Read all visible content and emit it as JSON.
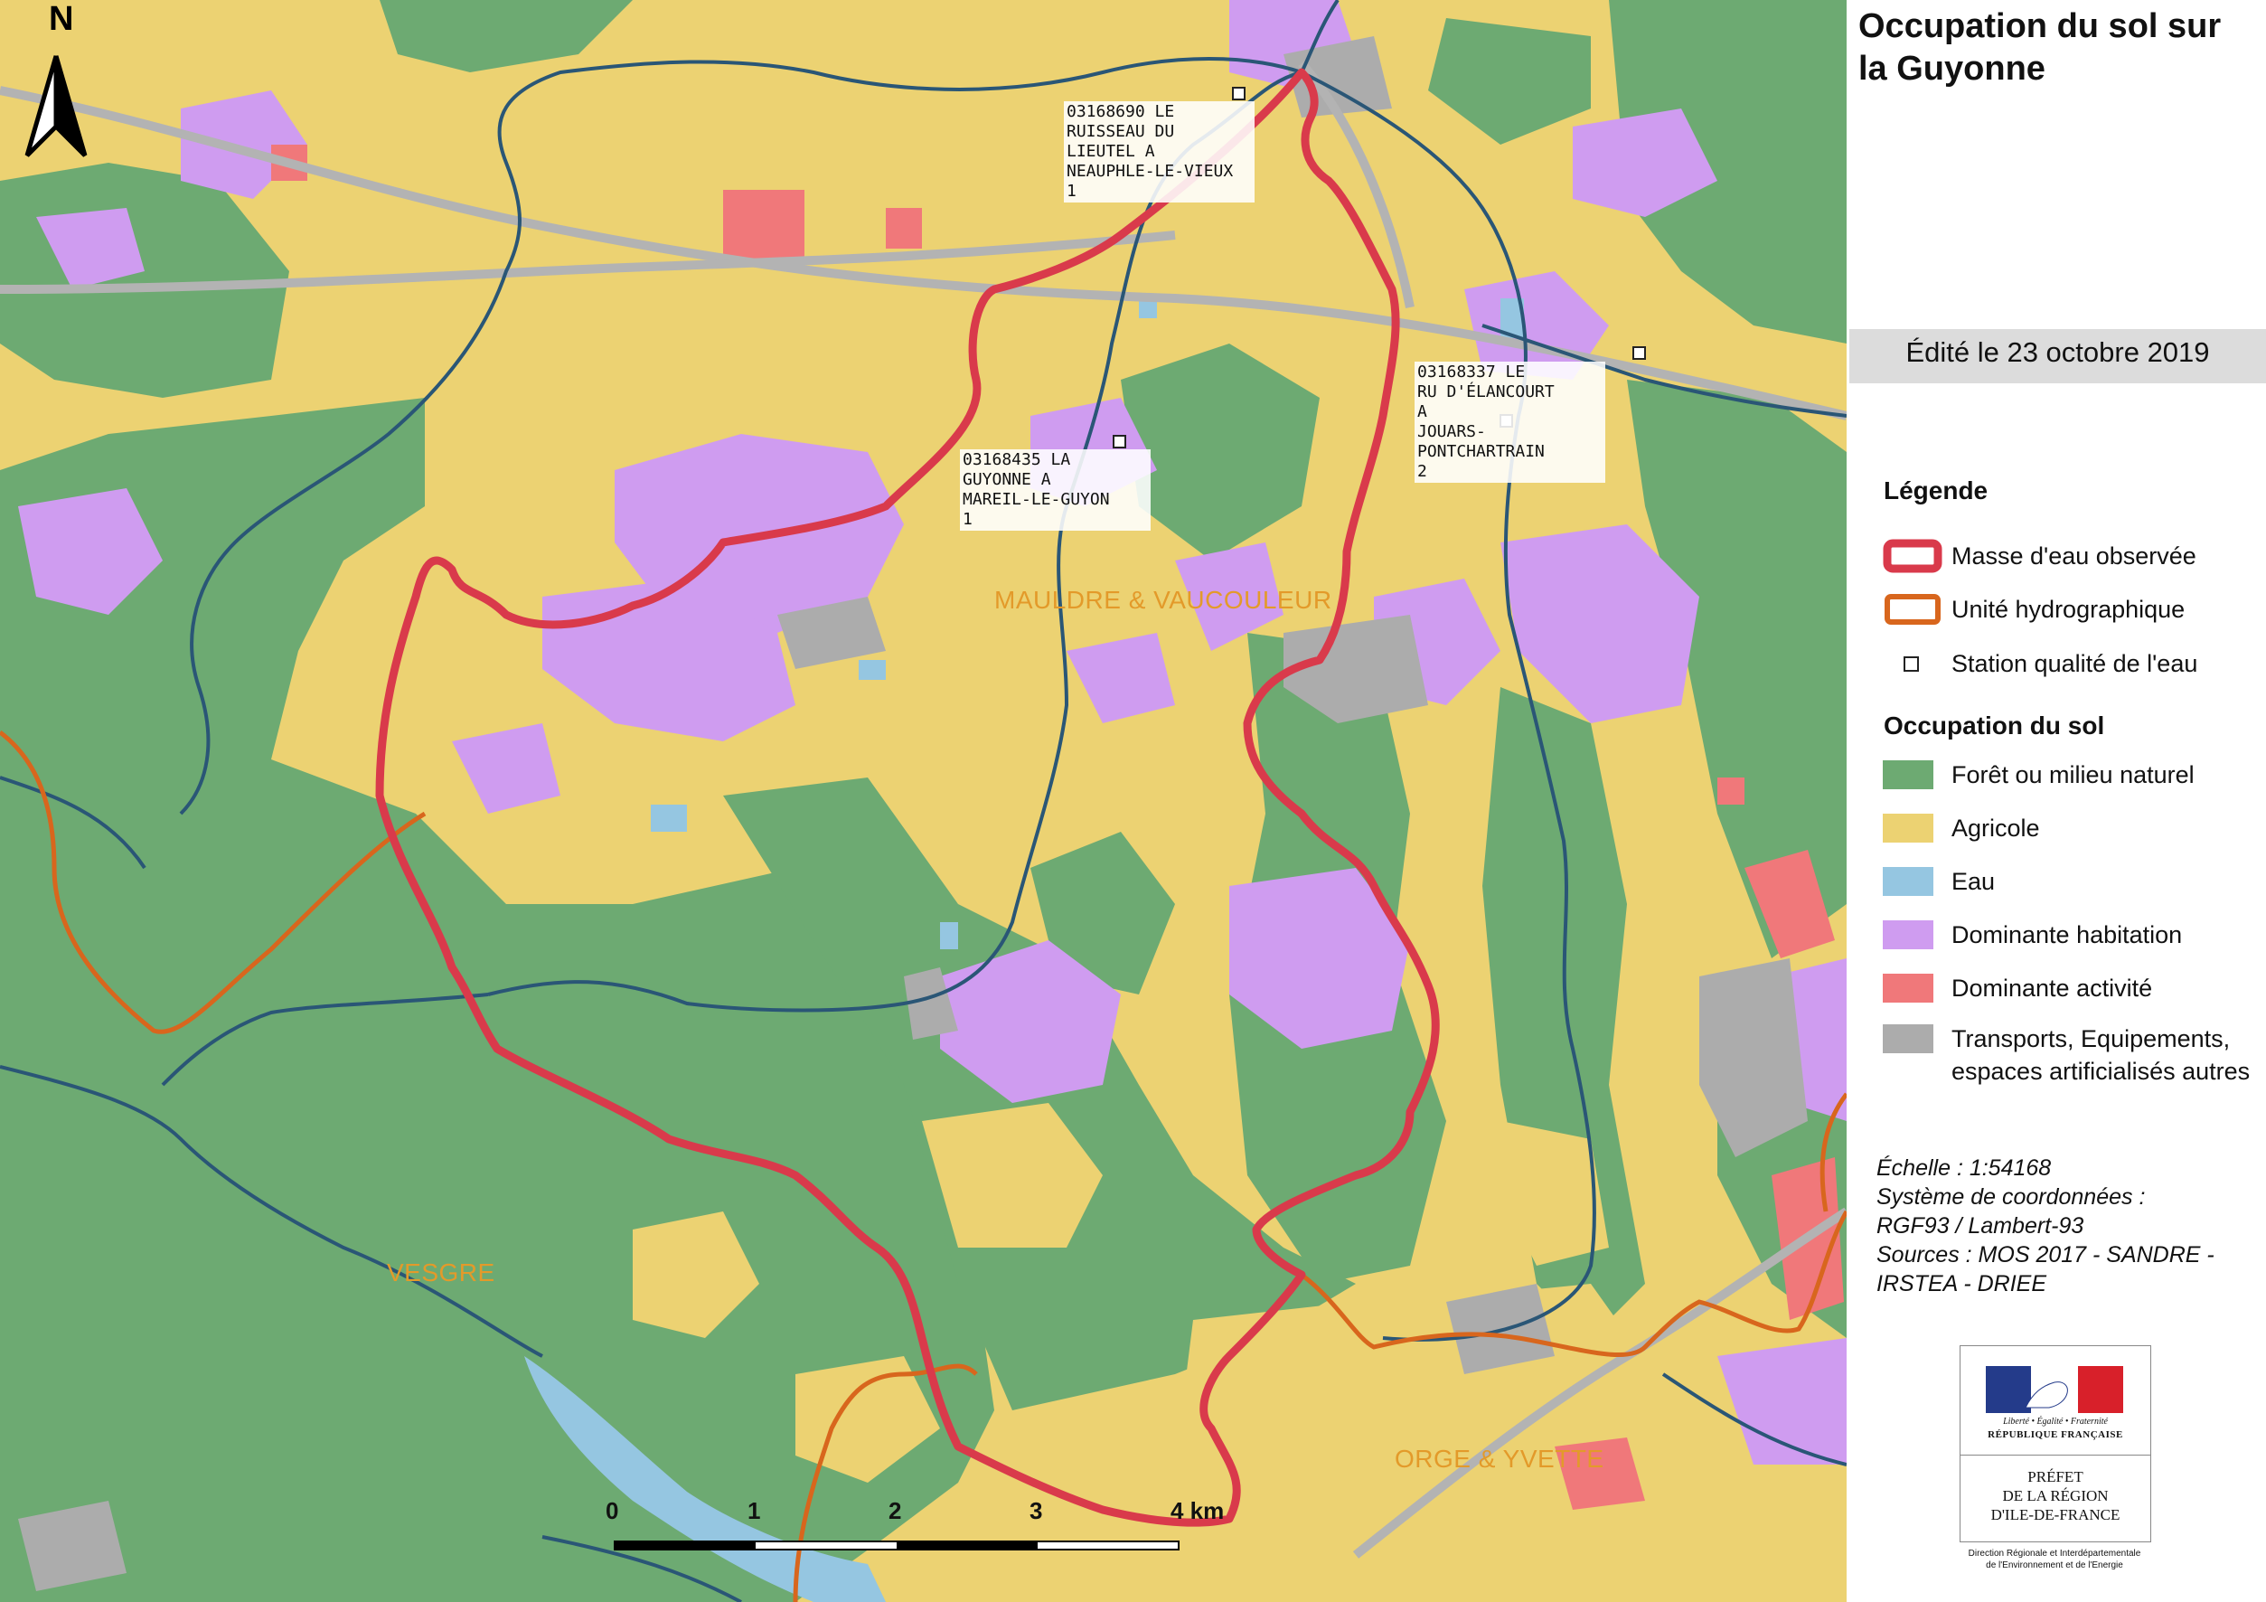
{
  "title": "Occupation du sol sur la Guyonne",
  "edit_date": "Édité le 23 octobre 2019",
  "north_label": "N",
  "legend": {
    "title": "Légende",
    "items": [
      {
        "label": "Masse d'eau observée",
        "symbol": "red-outline"
      },
      {
        "label": "Unité hydrographique",
        "symbol": "orange-outline"
      },
      {
        "label": "Station qualité de l'eau",
        "symbol": "white-square"
      }
    ],
    "landuse_title": "Occupation du sol",
    "landuse": [
      {
        "label": "Forêt ou milieu naturel",
        "color": "#6daa72"
      },
      {
        "label": "Agricole",
        "color": "#ecd272"
      },
      {
        "label": "Eau",
        "color": "#95c6e1"
      },
      {
        "label": "Dominante habitation",
        "color": "#cf9cf0"
      },
      {
        "label": "Dominante activité",
        "color": "#f0787a"
      },
      {
        "label": "Transports, Equipements, espaces artificialisés autres",
        "color": "#acacac"
      }
    ]
  },
  "scale_info": {
    "echelle": "Échelle :  1:54168",
    "crs_label": "Système de coordonnées :",
    "crs": "RGF93 / Lambert-93",
    "sources_1": "Sources : MOS 2017 - SANDRE -",
    "sources_2": "IRSTEA - DRIEE"
  },
  "stations": [
    {
      "label": "03168690   LE\nRUISSEAU DU\nLIEUTEL A\nNEAUPHLE-LE-VIEUX\n1"
    },
    {
      "label": "03168337   LE\nRU D'ÉLANCOURT\nA\nJOUARS-PONTCHARTRAIN\n2"
    },
    {
      "label": "03168435   LA\nGUYONNE A\nMAREIL-LE-GUYON\n1"
    }
  ],
  "regions": {
    "mauldre": "MAULDRE & VAUCOULEUR",
    "vesgre": "VESGRE",
    "orge": "ORGE & YVETTE"
  },
  "scale_bar": {
    "labels": [
      "0",
      "1",
      "2",
      "3",
      "4 km"
    ]
  },
  "logo": {
    "motto": "Liberté • Égalité • Fraternité",
    "republic": "RÉPUBLIQUE FRANÇAISE",
    "prefet": "PRÉFET\nDE LA RÉGION\nD'ILE-DE-FRANCE",
    "direction": "Direction Régionale et Interdépartementale\nde l'Environnement et de l'Energie"
  },
  "colors": {
    "forest": "#6daa72",
    "agri": "#ecd272",
    "water": "#95c6e1",
    "habitation": "#cf9cf0",
    "activite": "#f0787a",
    "transport": "#acacac",
    "masse_eau": "#d93a4b",
    "unite_hydro": "#d8661d",
    "river": "#2a5676"
  }
}
